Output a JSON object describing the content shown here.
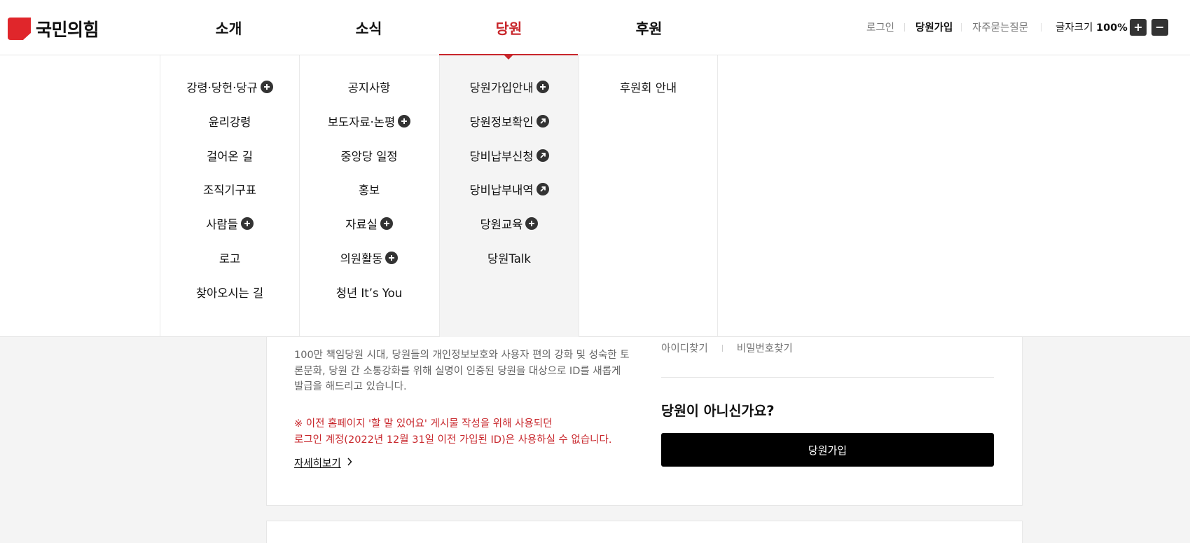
{
  "header": {
    "logo_text": "국민의힘",
    "nav": [
      {
        "label": "소개"
      },
      {
        "label": "소식"
      },
      {
        "label": "당원"
      },
      {
        "label": "후원"
      }
    ],
    "util": {
      "login": "로그인",
      "join": "당원가입",
      "faq": "자주묻는질문",
      "fontsize_label": "글자크기",
      "fontsize_value": "100%",
      "plus": "+",
      "minus": "−"
    }
  },
  "mega_menu": [
    {
      "items": [
        {
          "label": "강령·당헌·당규",
          "icon": "plus-circle-icon"
        },
        {
          "label": "윤리강령"
        },
        {
          "label": "걸어온 길"
        },
        {
          "label": "조직기구표"
        },
        {
          "label": "사람들",
          "icon": "plus-circle-icon"
        },
        {
          "label": "로고"
        },
        {
          "label": "찾아오시는 길"
        }
      ]
    },
    {
      "items": [
        {
          "label": "공지사항"
        },
        {
          "label": "보도자료·논평",
          "icon": "plus-circle-icon"
        },
        {
          "label": "중앙당 일정"
        },
        {
          "label": "홍보"
        },
        {
          "label": "자료실",
          "icon": "plus-circle-icon"
        },
        {
          "label": "의원활동",
          "icon": "plus-circle-icon"
        },
        {
          "label": "청년 It’s You"
        }
      ]
    },
    {
      "items": [
        {
          "label": "당원가입안내",
          "icon": "plus-circle-icon"
        },
        {
          "label": "당원정보확인",
          "icon": "external-link-icon"
        },
        {
          "label": "당비납부신청",
          "icon": "external-link-icon"
        },
        {
          "label": "당비납부내역",
          "icon": "external-link-icon"
        },
        {
          "label": "당원교육",
          "icon": "plus-circle-icon"
        },
        {
          "label": "당원Talk"
        }
      ]
    },
    {
      "items": [
        {
          "label": "후원회 안내"
        }
      ]
    }
  ],
  "content": {
    "description": "100만 책임당원 시대, 당원들의 개인정보보호와 사용자 편의 강화 및 성숙한 토론문화, 당원 간 소통강화를 위해 실명이 인증된 당원을 대상으로 ID를 새롭게 발급을 해드리고 있습니다.",
    "warning_line1": "※ 이전 홈페이지 '할 말 있어요' 게시물 작성을 위해 사용되던",
    "warning_line2": "로그인 계정(2022년 12월 31일 이전 가입된 ID)은 사용하실 수 없습니다.",
    "more": "자세히보기",
    "find_id": "아이디찾기",
    "find_pw": "비밀번호찾기",
    "not_member": "당원이 아니신가요?",
    "join_button": "당원가입"
  },
  "colors": {
    "brand_red": "#c8262b",
    "dark_button": "#333333"
  }
}
